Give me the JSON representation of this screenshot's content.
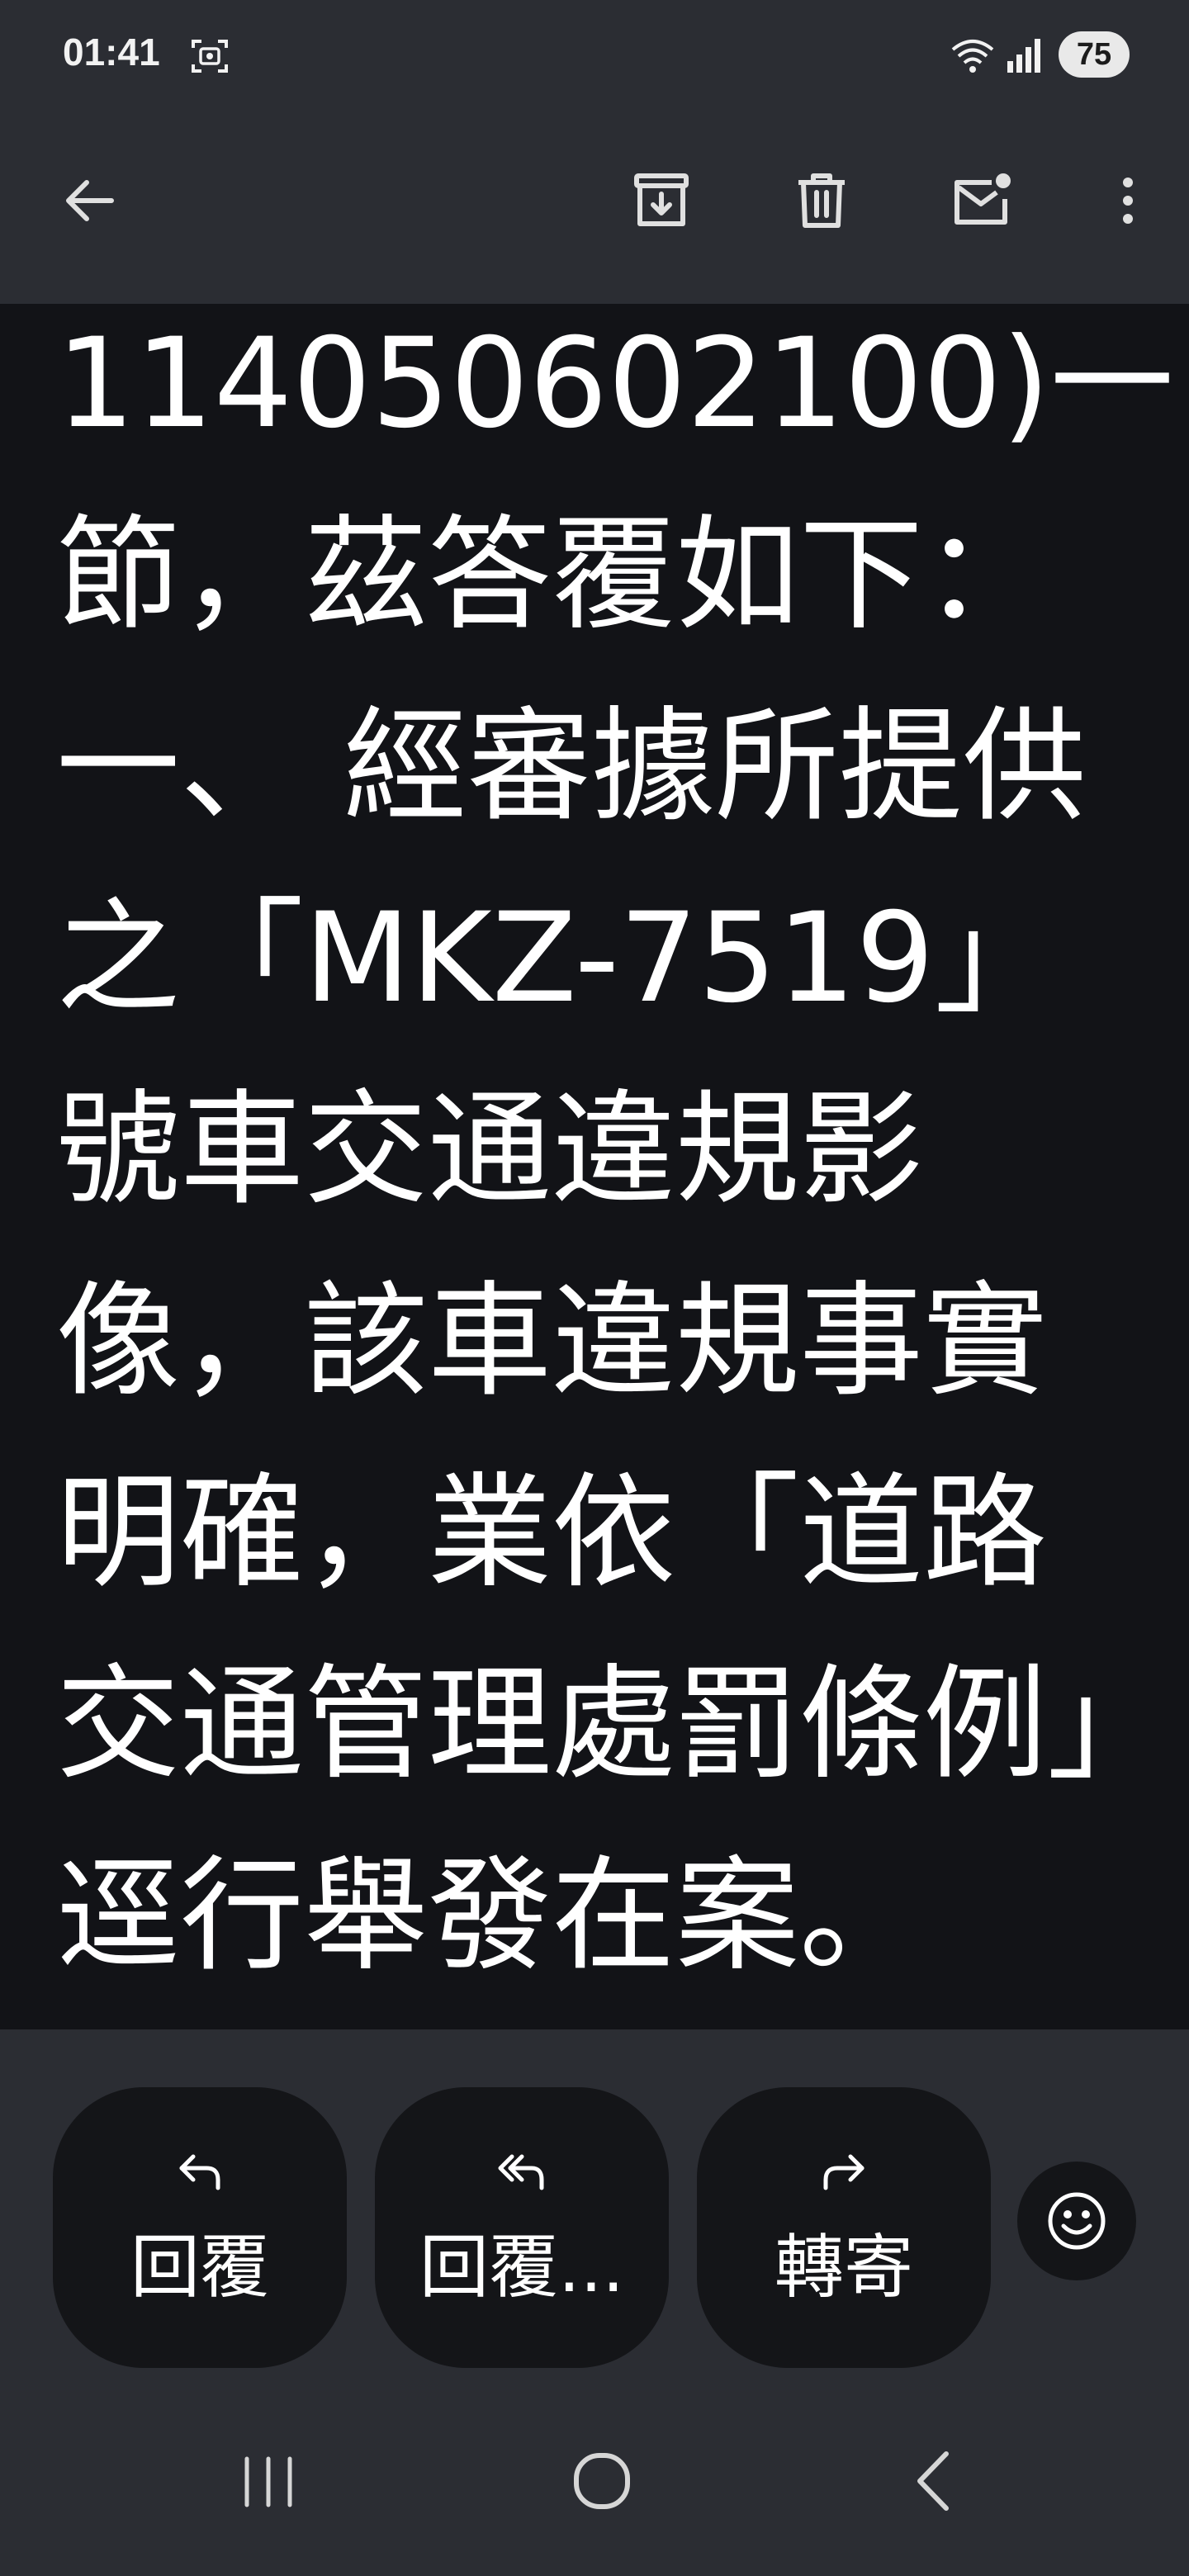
{
  "status_bar": {
    "time": "01:41",
    "battery": "75",
    "icons": [
      "screenshot-icon",
      "wifi-icon",
      "signal-icon"
    ]
  },
  "toolbar": {
    "icons": [
      "back-arrow-icon",
      "archive-icon",
      "trash-icon",
      "mark-unread-icon",
      "more-vert-icon"
    ]
  },
  "email_body": {
    "lines": [
      "114050602100)一",
      "節，茲答覆如下：",
      "一、 經審據所提供",
      "之「MKZ-7519」",
      "號車交通違規影",
      "像，該車違規事實",
      "明確，業依「道路",
      "交通管理處罰條例」",
      "逕行舉發在案。"
    ]
  },
  "actions": {
    "reply": "回覆",
    "reply_all": "回覆...",
    "forward": "轉寄"
  },
  "colors": {
    "bar_background": "#2b2d33",
    "content_background": "#121317",
    "button_background": "#141518",
    "text": "#ffffff"
  }
}
